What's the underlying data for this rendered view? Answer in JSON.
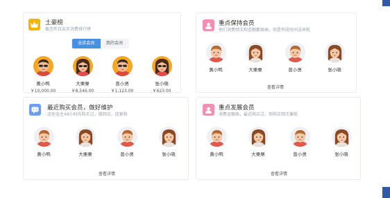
{
  "colors": {
    "accent": "#4a90e2",
    "crown": "#f5b400",
    "pink": "#f58fb0",
    "blue_icon": "#6b9ff5",
    "corner": "#2f5aa8"
  },
  "rich_list": {
    "title": "土豪榜",
    "subtitle": "截至昨日会员消费排行榜",
    "icon": "crown-icon",
    "tabs": [
      "全店会员",
      "我的会员"
    ],
    "members": [
      {
        "name": "黄小鸭",
        "value": "￥10,000.00"
      },
      {
        "name": "大栗栗",
        "value": "￥8,546.00"
      },
      {
        "name": "曾小贤",
        "value": "￥1,123.00"
      },
      {
        "name": "张小晓",
        "value": "￥623.00"
      }
    ]
  },
  "keep_members": {
    "title": "重点保持会员",
    "subtitle": "他们消费频次和金额都很高，但是有段时间没来啦",
    "icon": "member-card-icon",
    "members": [
      "黄小鸭",
      "大栗栗",
      "曾小贤",
      "张小晓"
    ],
    "more": "查看详情"
  },
  "recent_buyers": {
    "title": "最近购买会员，做好维护",
    "subtitle": "这些金主48小时内购买过，做回访，促复购",
    "icon": "chat-bubble-icon",
    "members": [
      "黄小鸭",
      "大栗栗",
      "曾小贤",
      "张小晓"
    ],
    "more": "查看详情"
  },
  "develop_members": {
    "title": "重点发展会员",
    "subtitle": "消费金额高，最近购买过，但购买频次偏低",
    "icon": "member-card-icon",
    "members": [
      "黄小鸭",
      "大栗栗",
      "曾小贤",
      "张小晓"
    ],
    "more": "查看详情"
  }
}
